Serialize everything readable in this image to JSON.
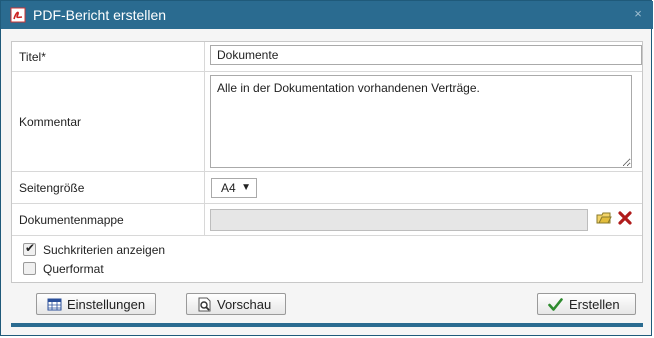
{
  "dialog": {
    "title": "PDF-Bericht erstellen",
    "close_glyph": "×"
  },
  "form": {
    "title_label": "Titel*",
    "title_value": "Dokumente",
    "comment_label": "Kommentar",
    "comment_value": "Alle in der Dokumentation vorhandenen Verträge.",
    "page_size_label": "Seitengröße",
    "page_size_value": "A4",
    "folder_label": "Dokumentenmappe",
    "folder_value": ""
  },
  "options": {
    "show_criteria_label": "Suchkriterien anzeigen",
    "show_criteria_checked": true,
    "landscape_label": "Querformat",
    "landscape_checked": false
  },
  "buttons": {
    "settings_label": "Einstellungen",
    "preview_label": "Vorschau",
    "create_label": "Erstellen"
  },
  "icons": {
    "app": "pdf-icon",
    "close": "close-icon",
    "folder": "folder-select-icon",
    "clear": "clear-x-icon",
    "settings": "table-icon",
    "preview": "magnifier-page-icon",
    "create": "checkmark-icon"
  },
  "colors": {
    "titlebar": "#2a6b90",
    "clear_red": "#b01b1b",
    "check_green": "#2e8b2e"
  }
}
